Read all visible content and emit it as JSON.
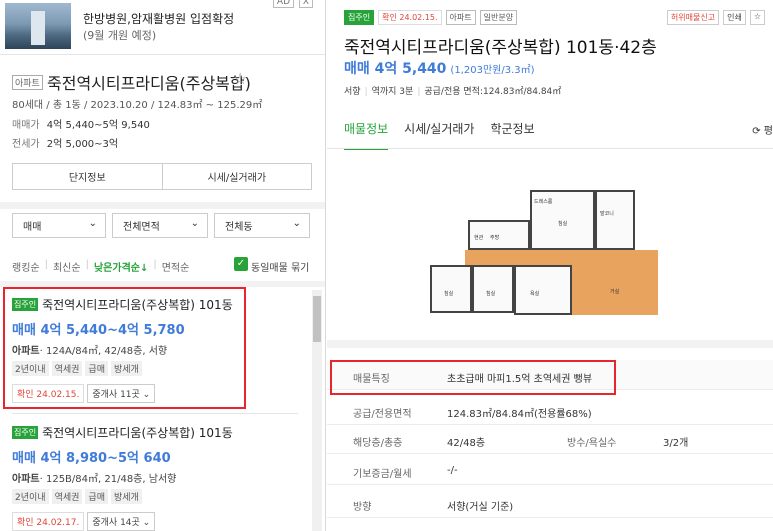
{
  "ad": {
    "title": "한방병원,암재활병원 입점확정",
    "subtitle": "(9월 개원 예정)",
    "badge": "AD",
    "close": "X"
  },
  "complex": {
    "type_tag": "아파트",
    "name": "죽전역시티프라디움(주상복합)",
    "star": "☆",
    "info": "80세대 / 총 1동 / 2023.10.20 / 124.83㎡ ~ 125.29㎡",
    "sale_label": "매매가",
    "sale_value": "4억 5,440~5억 9,540",
    "jeonse_label": "전세가",
    "jeonse_value": "2억 5,000~3억",
    "btn_info": "단지정보",
    "btn_market": "시세/실거래가"
  },
  "filters": {
    "deal": "매매",
    "area": "전체면적",
    "dong": "전체동",
    "chevron": "⌄"
  },
  "sort": {
    "ranking": "랭킹순",
    "latest": "최신순",
    "low_price": "낮은가격순↓",
    "area": "면적순",
    "check": "✓",
    "group_label": "동일매물 묶기",
    "sep": "|"
  },
  "listings": [
    {
      "badge": "집주인",
      "title": "죽전역시티프라디움(주상복합) 101동",
      "price": "매매 4억 5,440~4억 5,780",
      "spec_type": "아파트",
      "spec": "· 124A/84㎡, 42/48층, 서향",
      "tags": [
        "2년이내",
        "역세권",
        "급매",
        "방세개"
      ],
      "confirmed": "확인 24.02.15.",
      "agents": "중개사 11곳 ⌄"
    },
    {
      "badge": "집주인",
      "title": "죽전역시티프라디움(주상복합) 101동",
      "price": "매매 4억 8,980~5억 640",
      "spec_type": "아파트",
      "spec": "· 125B/84㎡, 21/48층, 남서향",
      "tags": [
        "2년이내",
        "역세권",
        "급매",
        "방세개"
      ],
      "confirmed": "확인 24.02.17.",
      "agents": "중개사 14곳 ⌄"
    }
  ],
  "detail": {
    "tags": [
      "집주인",
      "확인 24.02.15.",
      "아파트",
      "일반분양"
    ],
    "report": "허위매물신고",
    "print": "인쇄",
    "star": "☆",
    "title": "죽전역시티프라디움(주상복합) 101동·42층",
    "price": "매매 4억 5,440",
    "price_per": "(1,203만원/3.3㎡)",
    "meta_dir": "서향",
    "meta_station": "역까지 3분",
    "meta_area": "공급/전용 면적:124.83㎡/84.84㎡",
    "meta_sep": "|",
    "tabs": [
      "매물정보",
      "시세/실거래가",
      "학군정보"
    ],
    "more": "⟳ 평",
    "rows": [
      {
        "k": "매물특징",
        "v": "초초급매 마피1.5억 초역세권 뻥뷰"
      },
      {
        "k": "공급/전용면적",
        "v": "124.83㎡/84.84㎡(전용률68%)"
      },
      {
        "k": "해당층/총층",
        "v": "42/48층",
        "k2": "방수/욕실수",
        "v2": "3/2개"
      },
      {
        "k": "기보증금/월세",
        "v": "-/-"
      },
      {
        "k": "방향",
        "v": "서향(거실 기준)"
      }
    ],
    "plan_labels": [
      "침실",
      "침실",
      "침실",
      "거실",
      "주방",
      "현관",
      "욕실",
      "드레스룸",
      "발코니"
    ]
  },
  "colors": {
    "accent_green": "#27a33a",
    "price_blue": "#3f7bd8",
    "highlight_red": "#e8242c",
    "floor_wood": "#e8a35f"
  }
}
